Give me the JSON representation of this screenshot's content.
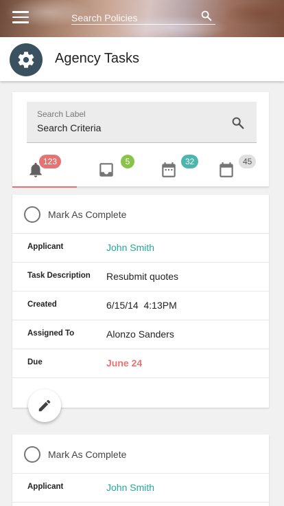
{
  "header": {
    "search_placeholder": "Search Policies",
    "menu_icon": "hamburger-menu-icon",
    "search_icon": "search-icon"
  },
  "titlebar": {
    "title": "Agency Tasks",
    "icon": "gear-icon"
  },
  "search": {
    "label": "Search Label",
    "value": "Search Criteria"
  },
  "tabs": [
    {
      "icon": "bell-icon",
      "count": "123",
      "badge_color": "#e57373",
      "active": true
    },
    {
      "icon": "inbox-icon",
      "count": "5",
      "badge_color": "#8bc34a",
      "active": false
    },
    {
      "icon": "calendar-icon",
      "count": "32",
      "badge_color": "#4db6ac",
      "active": false
    },
    {
      "icon": "calendar-blank-icon",
      "count": "45",
      "badge_color": "#e0e0e0",
      "active": false
    }
  ],
  "tasks": [
    {
      "complete_label": "Mark As Complete",
      "fields": {
        "applicant_label": "Applicant",
        "applicant_value": "John Smith",
        "description_label": "Task Description",
        "description_value": "Resubmit quotes",
        "created_label": "Created",
        "created_value": "6/15/14  4:13PM",
        "assigned_label": "Assigned To",
        "assigned_value": "Alonzo Sanders",
        "due_label": "Due",
        "due_value": "June 24"
      }
    },
    {
      "complete_label": "Mark As Complete",
      "fields": {
        "applicant_label": "Applicant",
        "applicant_value": "John Smith"
      }
    }
  ],
  "colors": {
    "accent_red": "#e57373",
    "accent_teal": "#26a69a",
    "gear_bg": "#3b5160"
  }
}
